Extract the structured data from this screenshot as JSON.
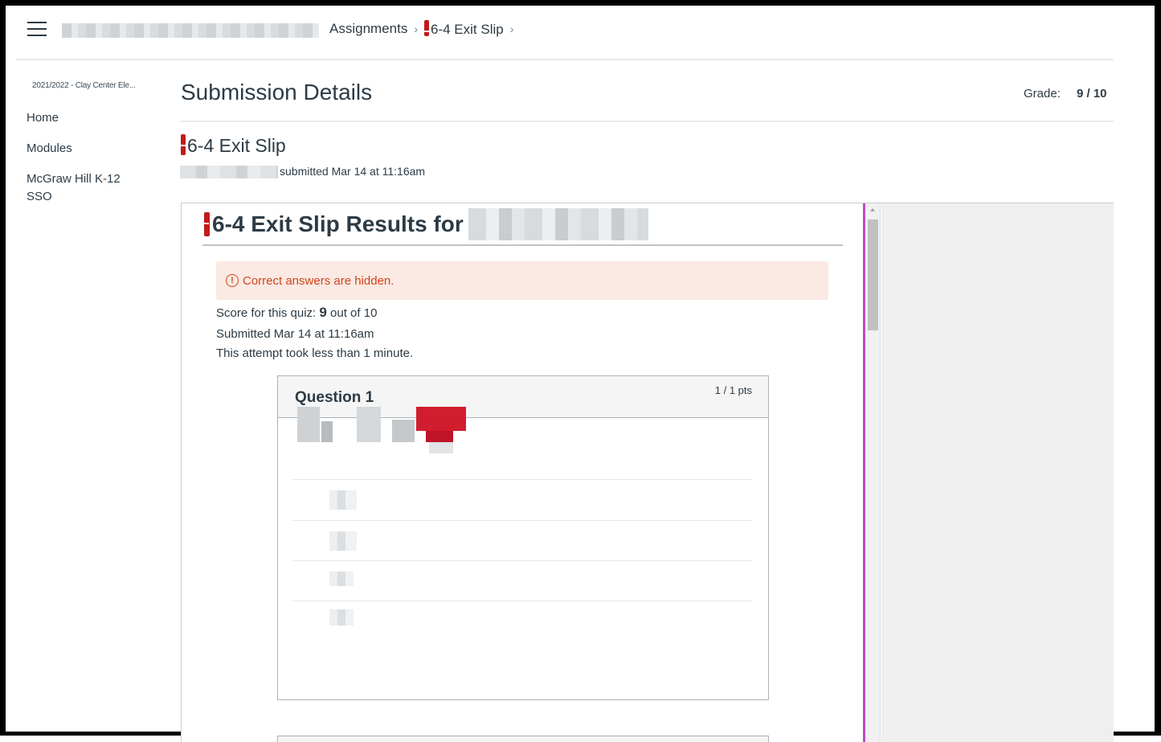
{
  "breadcrumb": {
    "items": [
      "Assignments",
      "6-4 Exit Slip"
    ],
    "separator": "›"
  },
  "nav": {
    "term": "2021/2022 - Clay Center Ele...",
    "items": [
      "Home",
      "Modules",
      "McGraw Hill K-12 SSO"
    ]
  },
  "submission": {
    "title": "Submission Details",
    "grade_label": "Grade:",
    "grade_value": "9 / 10",
    "assignment_name": "6-4 Exit Slip",
    "submitted_text": "submitted Mar 14 at 11:16am"
  },
  "results": {
    "title": "6-4 Exit Slip Results for",
    "alert": "Correct answers are hidden.",
    "score_prefix": "Score for this quiz:",
    "score": "9",
    "score_suffix": "out of 10",
    "submitted": "Submitted Mar 14 at 11:16am",
    "attempt": "This attempt took less than 1 minute."
  },
  "question": {
    "title": "Question 1",
    "points": "1 / 1 pts"
  },
  "colors": {
    "alert_text": "#d0451b",
    "alert_bg": "#fbe9e3",
    "exclamation": "#c21a1a",
    "panel_divider": "#c04bc9"
  }
}
